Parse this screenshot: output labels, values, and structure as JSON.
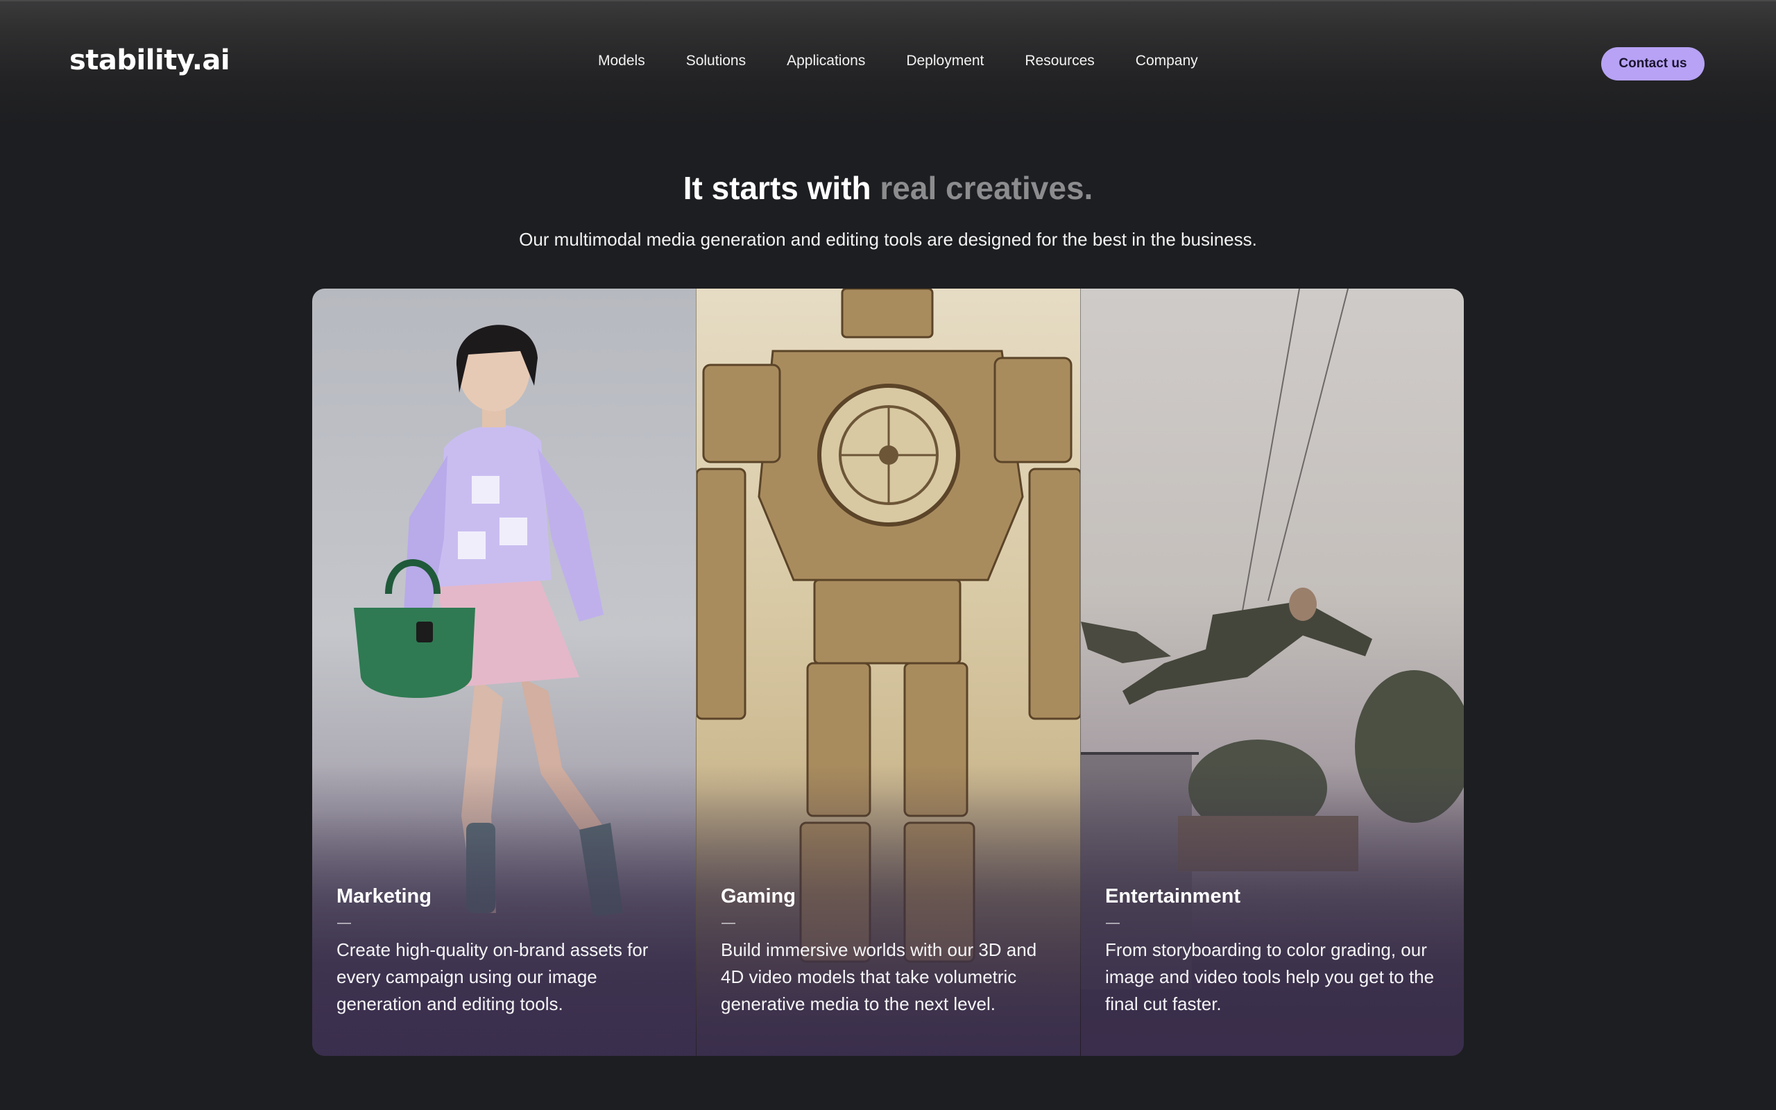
{
  "header": {
    "logo": "stability.ai",
    "nav": [
      "Models",
      "Solutions",
      "Applications",
      "Deployment",
      "Resources",
      "Company"
    ],
    "cta_label": "Contact us"
  },
  "hero": {
    "headline_main": "It starts with",
    "headline_accent": "real creatives.",
    "subheadline": "Our multimodal media generation and editing tools are designed for the best in the business."
  },
  "cards": [
    {
      "title": "Marketing",
      "description": "Create high-quality on-brand assets for every campaign using our image generation and editing tools."
    },
    {
      "title": "Gaming",
      "description": "Build immersive worlds with our 3D and 4D video models that take volumetric generative media to the next level."
    },
    {
      "title": "Entertainment",
      "description": "From storyboarding to color grading, our image and video tools help you get to the final cut faster."
    }
  ],
  "colors": {
    "background": "#1d1e21",
    "cta": "#b7a2f5",
    "headline_accent": "#8c8c8f"
  }
}
